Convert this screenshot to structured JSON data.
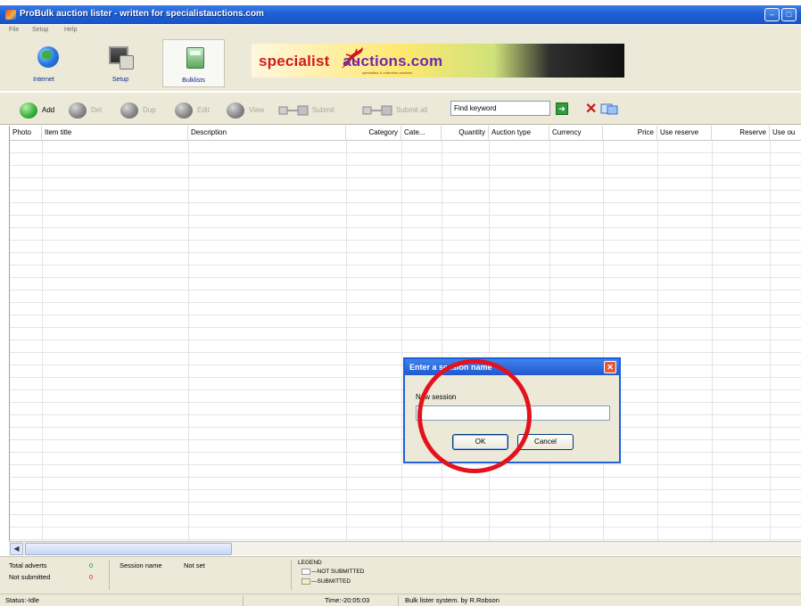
{
  "window": {
    "title": "ProBulk auction lister - written for specialistauctions.com"
  },
  "menu": {
    "items": [
      "File",
      "Setup",
      "Help"
    ]
  },
  "main_toolbar": {
    "buttons": [
      {
        "label": "Internet",
        "icon": "globe-icon"
      },
      {
        "label": "Setup",
        "icon": "computer-icon"
      },
      {
        "label": "Bulklists",
        "icon": "calculator-icon",
        "selected": true
      }
    ],
    "banner": {
      "logo_left": "specialist",
      "logo_right": "auctions.com",
      "tagline": "specialists & collectors auctions"
    }
  },
  "action_toolbar": {
    "add": "Add",
    "del": "Del",
    "dup": "Dup",
    "edit": "Edit",
    "view": "View",
    "submit": "Submit",
    "submit_all": "Submit all",
    "find_value": "Find keyword"
  },
  "grid": {
    "columns": [
      "Photo",
      "Item title",
      "Description",
      "Category",
      "Cate...",
      "Quantity",
      "Auction type",
      "Currency",
      "Price",
      "Use reserve",
      "Reserve",
      "Use ou"
    ]
  },
  "info": {
    "total_adverts_label": "Total adverts",
    "total_adverts_value": "0",
    "not_submitted_label": "Not submitted",
    "not_submitted_value": "0",
    "session_name_label": "Session name",
    "session_name_value": "Not set",
    "legend_title": "LEGEND",
    "legend_not_submitted": "—NOT SUBMITTED",
    "legend_submitted": "—SUBMITTED"
  },
  "status": {
    "status_text": "Status:-Idle",
    "time_text": "Time:-20:05:03",
    "credit_text": "Bulk lister system. by R.Robson"
  },
  "dialog": {
    "title": "Enter a session name",
    "label": "New session",
    "input_value": "",
    "ok": "OK",
    "cancel": "Cancel"
  },
  "colors": {
    "accent": "#1f5fd8",
    "annotation": "#e3121d",
    "count_green": "#1a9a1a",
    "count_red": "#d42020"
  }
}
